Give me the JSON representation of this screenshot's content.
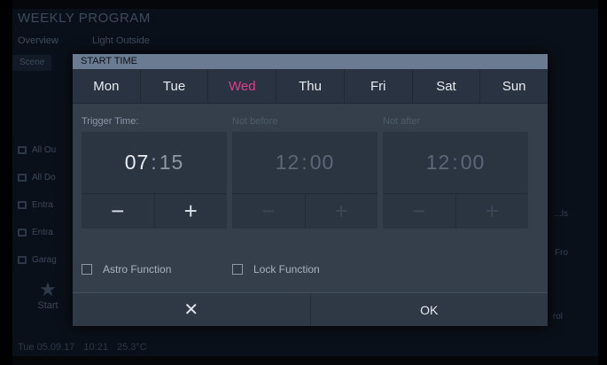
{
  "background": {
    "title": "WEEKLY PROGRAM",
    "tabs": [
      "Overview",
      "Light Outside"
    ],
    "subtab": "Scene",
    "list_items": [
      "All Ou",
      "All Do",
      "Entra",
      "Entra",
      "Garag"
    ],
    "start_label": "Start",
    "right_labels": [
      "...ls",
      "Fro",
      "rol"
    ],
    "status": [
      "Tue 05.09.17",
      "10:21",
      "25.3°C"
    ]
  },
  "dialog": {
    "title": "START TIME",
    "days": [
      {
        "label": "Mon",
        "active": false
      },
      {
        "label": "Tue",
        "active": false
      },
      {
        "label": "Wed",
        "active": true
      },
      {
        "label": "Thu",
        "active": false
      },
      {
        "label": "Fri",
        "active": false
      },
      {
        "label": "Sat",
        "active": false
      },
      {
        "label": "Sun",
        "active": false
      }
    ],
    "times": [
      {
        "label": "Trigger Time:",
        "hours": "07",
        "minutes": "15",
        "enabled": true
      },
      {
        "label": "Not before",
        "hours": "12",
        "minutes": "00",
        "enabled": false
      },
      {
        "label": "Not after",
        "hours": "12",
        "minutes": "00",
        "enabled": false
      }
    ],
    "minus_symbol": "−",
    "plus_symbol": "+",
    "options": {
      "astro": {
        "label": "Astro Function",
        "checked": false
      },
      "lock": {
        "label": "Lock Function",
        "checked": false
      }
    },
    "cancel_icon": "close-icon",
    "cancel_symbol": "✕",
    "ok_label": "OK"
  },
  "colors": {
    "active_day": "#e43d8c",
    "header_bar": "#6b7c92",
    "dialog_bg": "#36414e"
  }
}
